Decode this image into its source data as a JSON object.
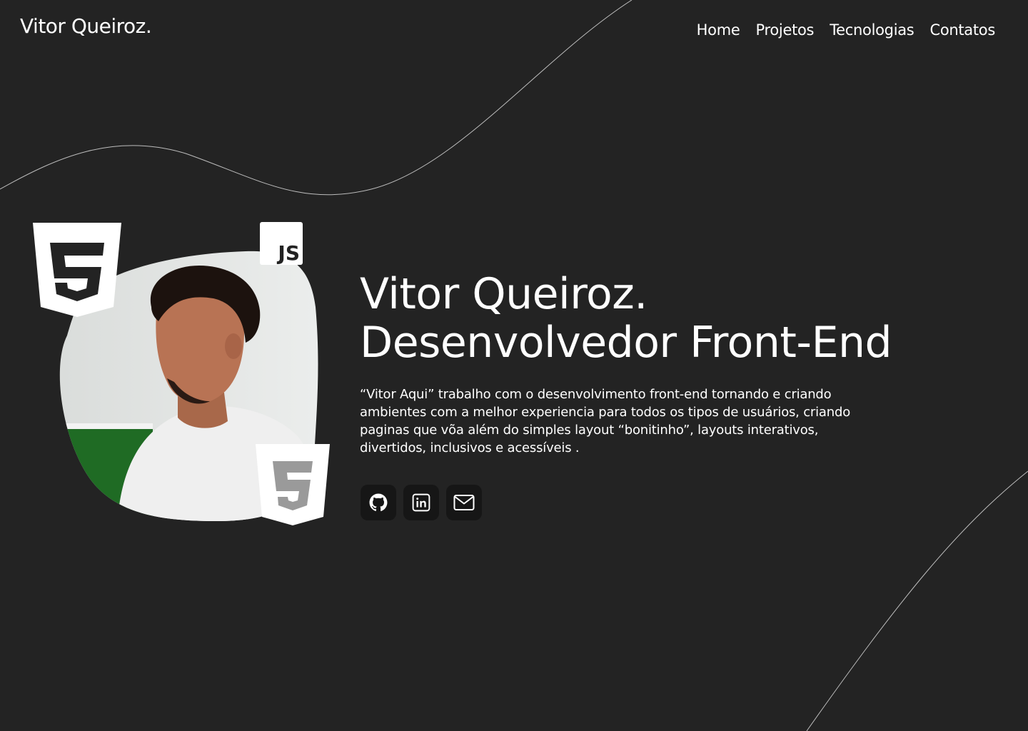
{
  "header": {
    "logo": "Vitor Queiroz.",
    "nav": [
      "Home",
      "Projetos",
      "Tecnologias",
      "Contatos"
    ]
  },
  "hero": {
    "name": "Vitor Queiroz.",
    "role": "Desenvolvedor Front-End",
    "description": "“Vitor Aqui” trabalho com o desenvolvimento front-end tornando e criando ambientes com a melhor experiencia para todos os tipos de usuários, criando paginas que võa além do simples layout “bonitinho”, layouts interativos, divertidos, inclusivos e acessíveis .",
    "badges": {
      "js": "JS"
    }
  },
  "socials": [
    {
      "name": "github",
      "icon": "github-icon"
    },
    {
      "name": "linkedin",
      "icon": "linkedin-icon"
    },
    {
      "name": "email",
      "icon": "mail-icon"
    }
  ],
  "colors": {
    "background": "#232323",
    "text": "#ffffff",
    "button_bg": "#161616"
  }
}
